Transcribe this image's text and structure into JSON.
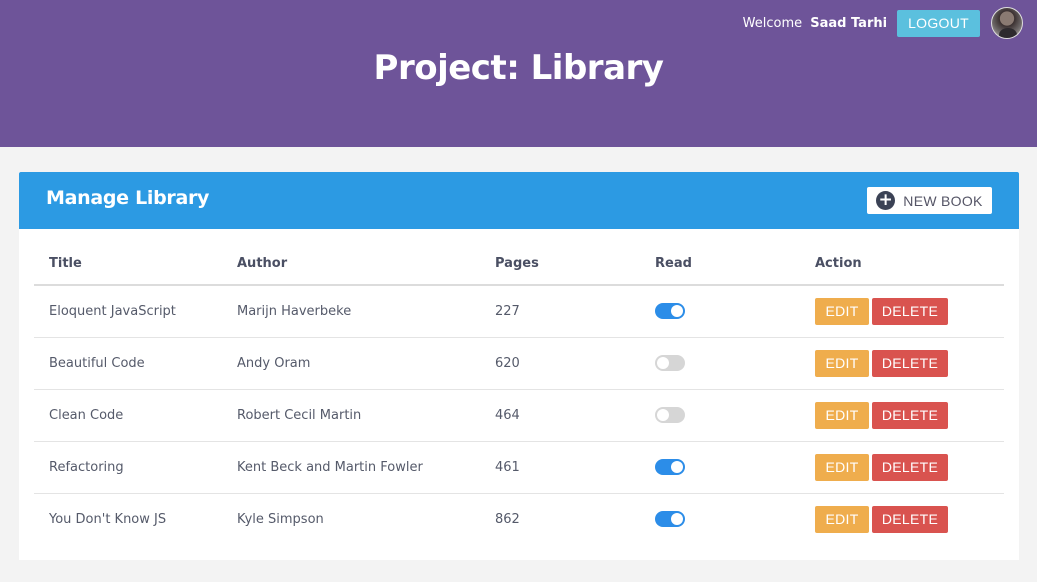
{
  "header": {
    "welcome_label": "Welcome",
    "user_name": "Saad Tarhi",
    "logout_label": "LOGOUT",
    "title": "Project: Library",
    "background_color": "#6e5499"
  },
  "card": {
    "title": "Manage Library",
    "new_book_label": "NEW BOOK",
    "accent_color": "#2c9ae3"
  },
  "table": {
    "headers": {
      "title": "Title",
      "author": "Author",
      "pages": "Pages",
      "read": "Read",
      "action": "Action"
    },
    "edit_label": "EDIT",
    "delete_label": "DELETE",
    "rows": [
      {
        "title": "Eloquent JavaScript",
        "author": "Marijn Haverbeke",
        "pages": "227",
        "read": true
      },
      {
        "title": "Beautiful Code",
        "author": "Andy Oram",
        "pages": "620",
        "read": false
      },
      {
        "title": "Clean Code",
        "author": "Robert Cecil Martin",
        "pages": "464",
        "read": false
      },
      {
        "title": "Refactoring",
        "author": "Kent Beck and Martin Fowler",
        "pages": "461",
        "read": true
      },
      {
        "title": "You Don't Know JS",
        "author": "Kyle Simpson",
        "pages": "862",
        "read": true
      }
    ]
  },
  "colors": {
    "toggle_on": "#2c8de8",
    "toggle_off": "#d6d6d6",
    "edit": "#efad4d",
    "delete": "#d9534f",
    "logout": "#5bc0de"
  }
}
